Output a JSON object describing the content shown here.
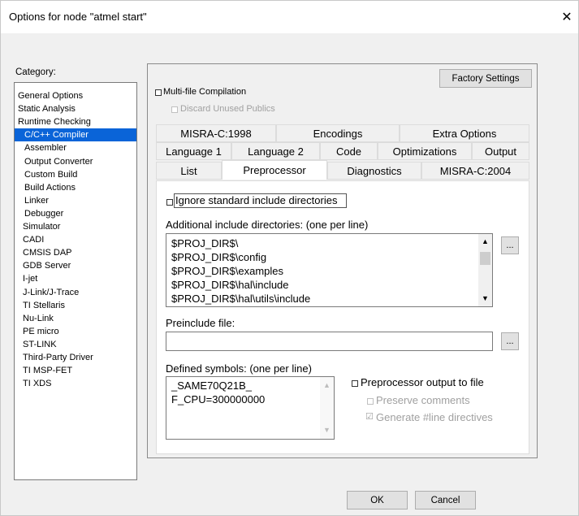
{
  "window": {
    "title": "Options for node \"atmel start\"",
    "close_glyph": "✕"
  },
  "category": {
    "label": "Category:",
    "items": [
      {
        "label": "General Options",
        "level": 1
      },
      {
        "label": "Static Analysis",
        "level": 1
      },
      {
        "label": "Runtime Checking",
        "level": 1
      },
      {
        "label": "C/C++ Compiler",
        "level": 2,
        "selected": true
      },
      {
        "label": "Assembler",
        "level": 2
      },
      {
        "label": "Output Converter",
        "level": 2
      },
      {
        "label": "Custom Build",
        "level": 2
      },
      {
        "label": "Build Actions",
        "level": 2
      },
      {
        "label": "Linker",
        "level": 2
      },
      {
        "label": "Debugger",
        "level": 2
      },
      {
        "label": "Simulator",
        "level": 3
      },
      {
        "label": "CADI",
        "level": 3
      },
      {
        "label": "CMSIS DAP",
        "level": 3
      },
      {
        "label": "GDB Server",
        "level": 3
      },
      {
        "label": "I-jet",
        "level": 3
      },
      {
        "label": "J-Link/J-Trace",
        "level": 3
      },
      {
        "label": "TI Stellaris",
        "level": 3
      },
      {
        "label": "Nu-Link",
        "level": 3
      },
      {
        "label": "PE micro",
        "level": 3
      },
      {
        "label": "ST-LINK",
        "level": 3
      },
      {
        "label": "Third-Party Driver",
        "level": 3
      },
      {
        "label": "TI MSP-FET",
        "level": 3
      },
      {
        "label": "TI XDS",
        "level": 3
      }
    ]
  },
  "panel": {
    "factory_settings": "Factory Settings",
    "multifile": "Multi-file Compilation",
    "discard": "Discard Unused Publics"
  },
  "tabs": {
    "row1": [
      "MISRA-C:1998",
      "Encodings",
      "Extra Options"
    ],
    "row2": [
      "Language 1",
      "Language 2",
      "Code",
      "Optimizations",
      "Output"
    ],
    "row3": [
      "List",
      "Preprocessor",
      "Diagnostics",
      "MISRA-C:2004"
    ],
    "active": "Preprocessor"
  },
  "preprocessor": {
    "ignore_std": "Ignore standard include directories",
    "additional_label": "Additional include directories: (one per line)",
    "include_dirs": [
      "$PROJ_DIR$\\",
      "$PROJ_DIR$\\config",
      "$PROJ_DIR$\\examples",
      "$PROJ_DIR$\\hal\\include",
      "$PROJ_DIR$\\hal\\utils\\include"
    ],
    "browse": "...",
    "preinclude_label": "Preinclude file:",
    "preinclude_value": "",
    "defined_label": "Defined symbols: (one per line)",
    "defined_symbols": [
      "_SAME70Q21B_",
      "F_CPU=300000000"
    ],
    "pp_output": "Preprocessor output to file",
    "preserve_comments": "Preserve comments",
    "generate_line": "Generate #line directives",
    "generate_line_checked_glyph": "☑"
  },
  "footer": {
    "ok": "OK",
    "cancel": "Cancel"
  }
}
